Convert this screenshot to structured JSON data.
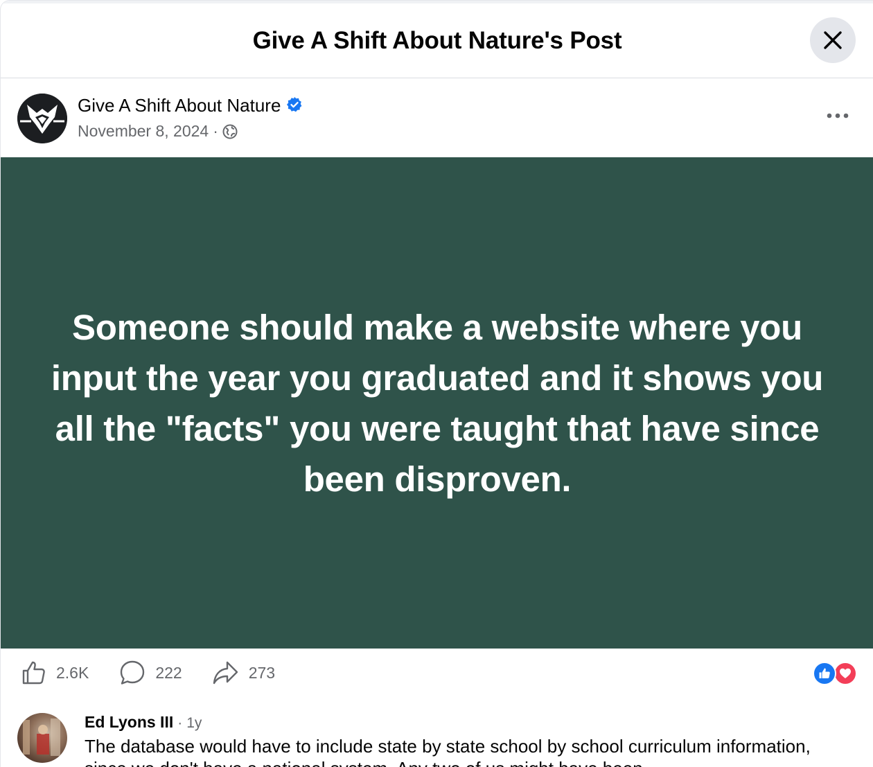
{
  "header": {
    "title": "Give A Shift About Nature's Post"
  },
  "post": {
    "author": "Give A Shift About Nature",
    "date": "November 8, 2024",
    "meta_separator": "·",
    "image_text": "Someone should make a website where you input the year you graduated and it shows you all the \"facts\" you were taught that have since been disproven.",
    "image_bg": "#2f534a"
  },
  "actions": {
    "likes": "2.6K",
    "comments": "222",
    "shares": "273"
  },
  "comment": {
    "author": "Ed Lyons III",
    "separator": "·",
    "time": "1y",
    "text": "The database would have to include state by state school by school curriculum information, since we don't have a national system. Any two of us might have been"
  },
  "colors": {
    "accent": "#1877f2",
    "love": "#f33e58",
    "muted": "#65676b"
  }
}
